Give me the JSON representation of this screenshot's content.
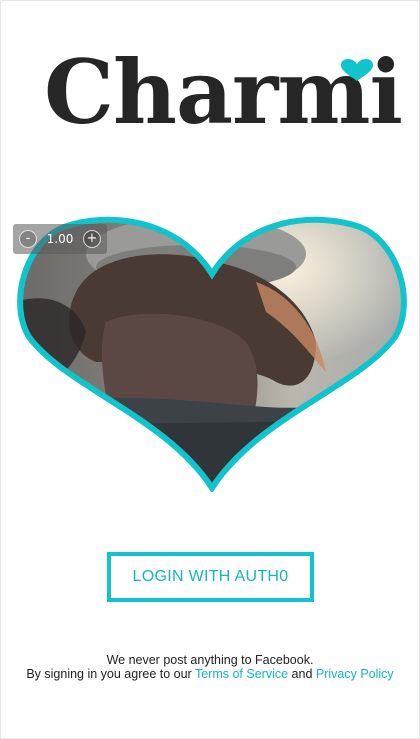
{
  "app": {
    "logo_text": "Charmi",
    "accent_color": "#11c4cc"
  },
  "photo": {
    "zoom": {
      "minus_label": "-",
      "value": "1.00",
      "plus_label": "+"
    }
  },
  "login": {
    "button_label": "LOGIN WITH AUTH0"
  },
  "footer": {
    "line1": "We never post anything to Facebook.",
    "line2_prefix": "By signing in you agree to our ",
    "terms_link": "Terms of Service",
    "and_text": " and ",
    "privacy_link": "Privacy Policy"
  }
}
